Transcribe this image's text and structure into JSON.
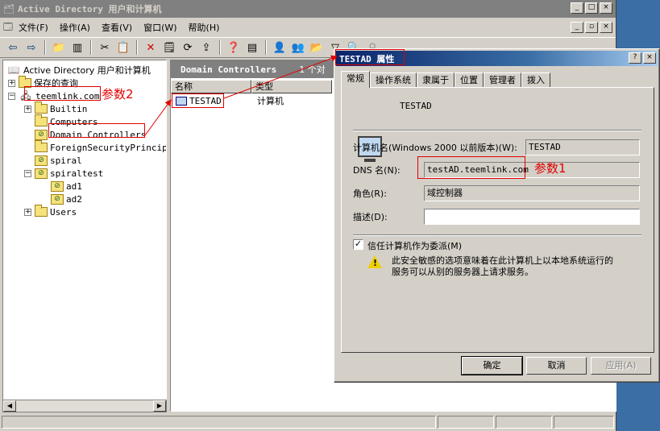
{
  "main_window": {
    "title": "Active Directory 用户和计算机",
    "title_buttons": [
      "_",
      "□",
      "×"
    ],
    "mdi_buttons": [
      "_",
      "▫",
      "×"
    ],
    "menu": [
      "文件(F)",
      "操作(A)",
      "查看(V)",
      "窗口(W)",
      "帮助(H)"
    ]
  },
  "tree": {
    "root": "Active Directory 用户和计算机",
    "items": [
      "保存的查询",
      "teemlink.com",
      "Builtin",
      "Computers",
      "Domain Controllers",
      "ForeignSecurityPrincipa",
      "spiral",
      "spiraltest",
      "ad1",
      "ad2",
      "Users"
    ]
  },
  "list": {
    "header_title": "Domain Controllers",
    "header_count": "1 个对",
    "columns": [
      "名称",
      "类型"
    ],
    "rows": [
      {
        "name": "TESTAD",
        "type": "计算机"
      }
    ]
  },
  "dialog": {
    "title": "TESTAD 属性",
    "title_buttons": [
      "?",
      "×"
    ],
    "tabs": [
      "常规",
      "操作系统",
      "隶属于",
      "位置",
      "管理者",
      "拨入"
    ],
    "computer_name": "TESTAD",
    "fields": {
      "pre2000_label": "计算机名(Windows 2000 以前版本)(W):",
      "pre2000_value": "TESTAD",
      "dns_label": "DNS 名(N):",
      "dns_value": "testAD.teemlink.com",
      "role_label": "角色(R):",
      "role_value": "域控制器",
      "desc_label": "描述(D):",
      "desc_value": ""
    },
    "trust_checkbox_label": "信任计算机作为委派(M)",
    "trust_checked": true,
    "warning_text_1": "此安全敏感的选项意味着在此计算机上以本地系统运行的",
    "warning_text_2": "服务可以从别的服务器上请求服务。",
    "buttons": {
      "ok": "确定",
      "cancel": "取消",
      "apply": "应用(A)"
    }
  },
  "annotations": {
    "note1": "参数1",
    "note2": "参数2",
    "color": "#e00000"
  }
}
